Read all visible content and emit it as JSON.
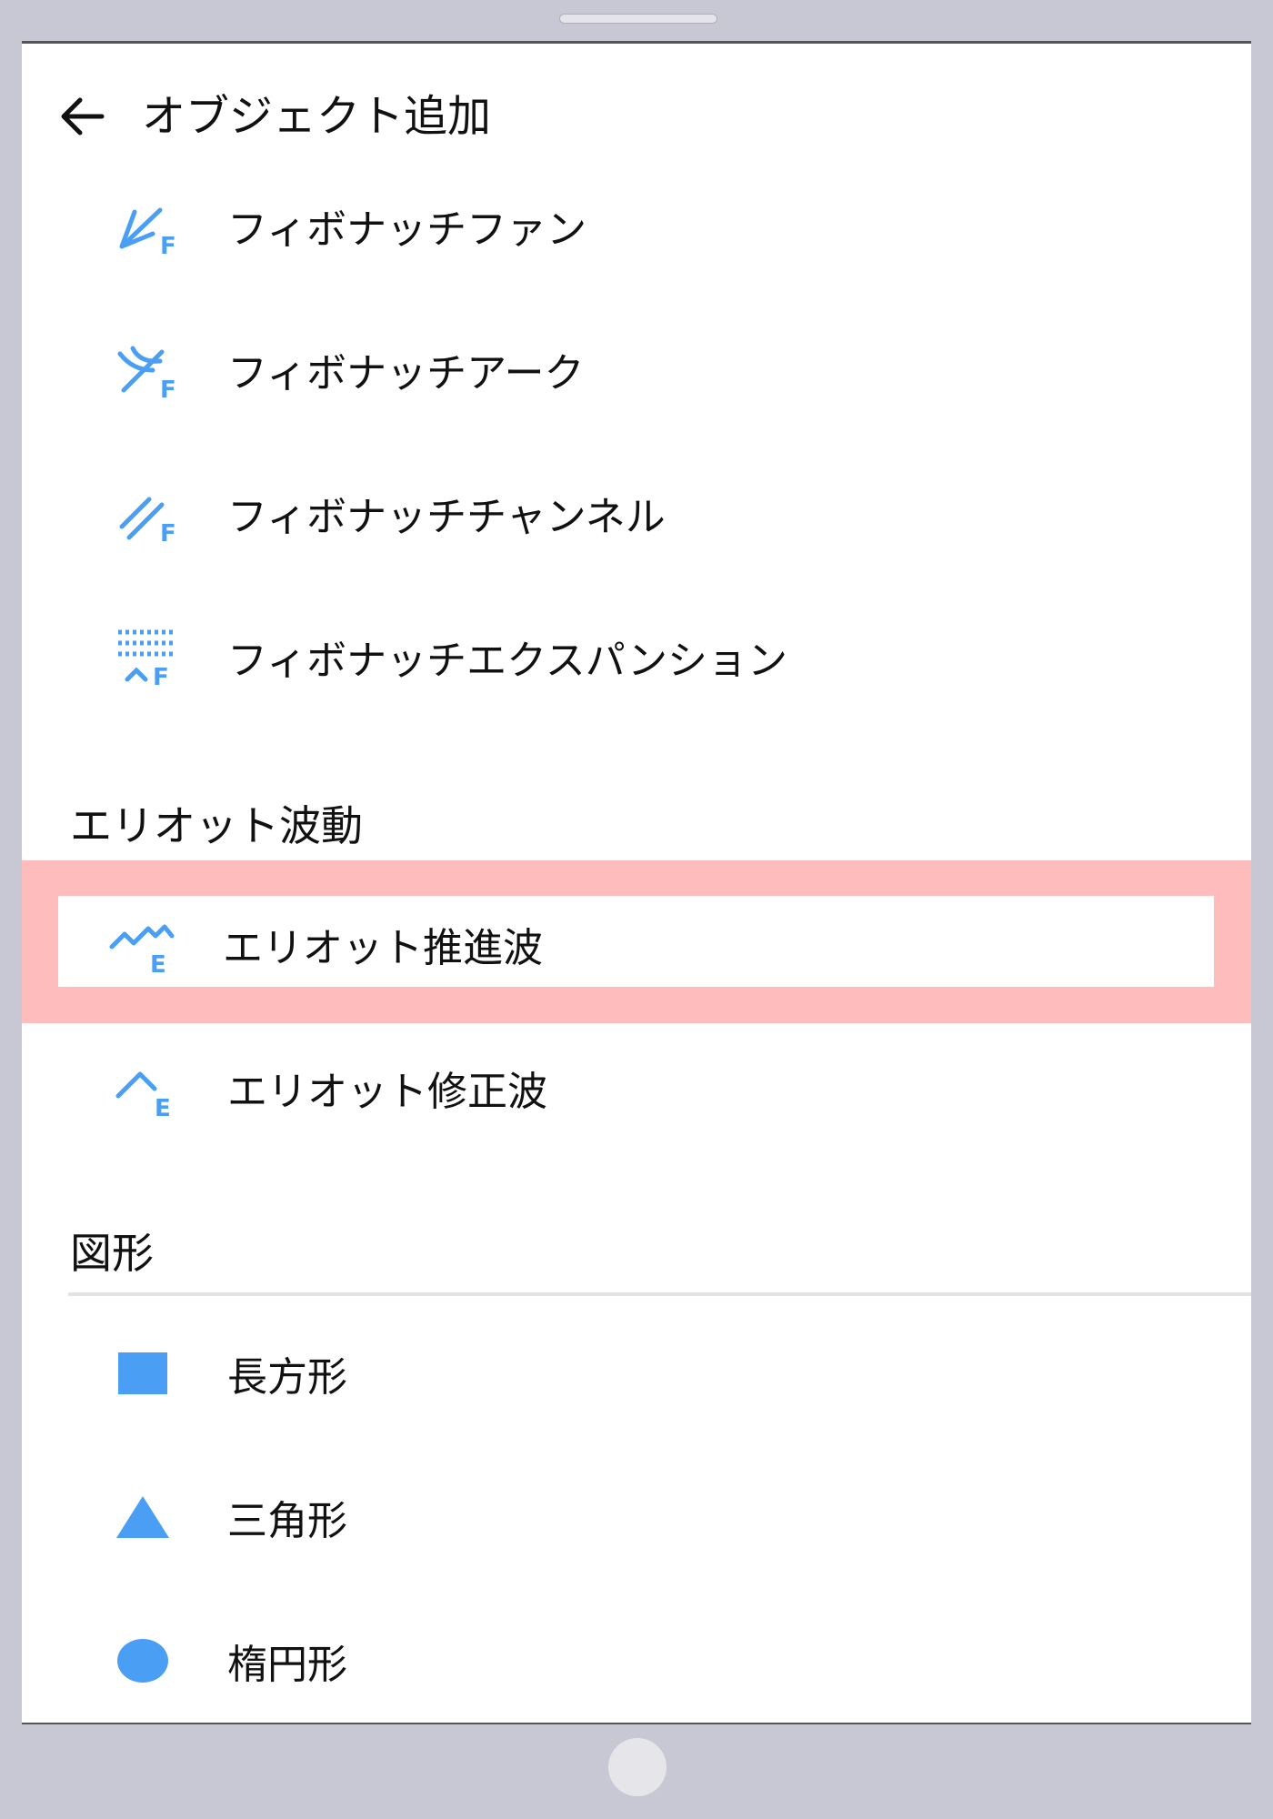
{
  "header": {
    "title": "オブジェクト追加",
    "back_icon": "arrow-left-icon"
  },
  "accent_color": "#4a9ff5",
  "highlight_color": "#ffbcbc",
  "fibonacci_items": [
    {
      "label": "フィボナッチファン",
      "icon": "fibonacci-fan-icon"
    },
    {
      "label": "フィボナッチアーク",
      "icon": "fibonacci-arc-icon"
    },
    {
      "label": "フィボナッチチャンネル",
      "icon": "fibonacci-channel-icon"
    },
    {
      "label": "フィボナッチエクスパンション",
      "icon": "fibonacci-expansion-icon"
    }
  ],
  "elliott": {
    "title": "エリオット波動",
    "items": [
      {
        "label": "エリオット推進波",
        "icon": "elliott-impulse-icon",
        "selected": true
      },
      {
        "label": "エリオット修正波",
        "icon": "elliott-correction-icon"
      }
    ]
  },
  "shapes": {
    "title": "図形",
    "items": [
      {
        "label": "長方形",
        "icon": "rectangle-icon"
      },
      {
        "label": "三角形",
        "icon": "triangle-icon"
      },
      {
        "label": "楕円形",
        "icon": "ellipse-icon"
      }
    ]
  }
}
